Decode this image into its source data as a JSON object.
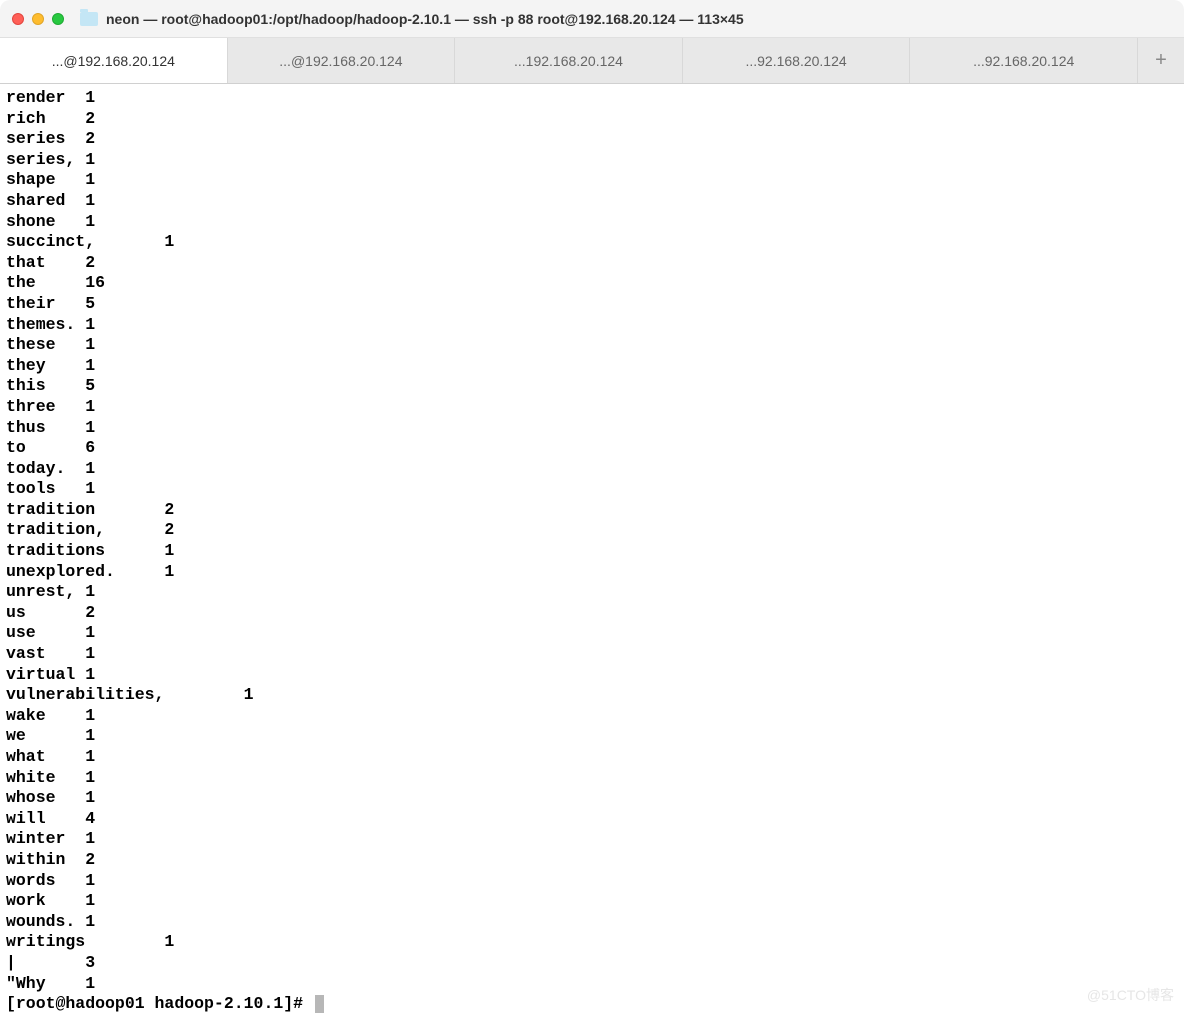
{
  "window": {
    "title": "neon — root@hadoop01:/opt/hadoop/hadoop-2.10.1 — ssh -p 88 root@192.168.20.124 — 113×45"
  },
  "tabs": [
    {
      "label": "...@192.168.20.124",
      "active": true
    },
    {
      "label": "...@192.168.20.124",
      "active": false
    },
    {
      "label": "...192.168.20.124",
      "active": false
    },
    {
      "label": "...92.168.20.124",
      "active": false
    },
    {
      "label": "...92.168.20.124",
      "active": false
    }
  ],
  "tab_add_glyph": "+",
  "terminal": {
    "col1_width": 8,
    "col1_width_long": 16,
    "wordcounts": [
      {
        "word": "render",
        "count": 1,
        "tab": 8
      },
      {
        "word": "rich",
        "count": 2,
        "tab": 8
      },
      {
        "word": "series",
        "count": 2,
        "tab": 8
      },
      {
        "word": "series,",
        "count": 1,
        "tab": 8
      },
      {
        "word": "shape",
        "count": 1,
        "tab": 8
      },
      {
        "word": "shared",
        "count": 1,
        "tab": 8
      },
      {
        "word": "shone",
        "count": 1,
        "tab": 8
      },
      {
        "word": "succinct,",
        "count": 1,
        "tab": 16
      },
      {
        "word": "that",
        "count": 2,
        "tab": 8
      },
      {
        "word": "the",
        "count": 16,
        "tab": 8
      },
      {
        "word": "their",
        "count": 5,
        "tab": 8
      },
      {
        "word": "themes.",
        "count": 1,
        "tab": 8
      },
      {
        "word": "these",
        "count": 1,
        "tab": 8
      },
      {
        "word": "they",
        "count": 1,
        "tab": 8
      },
      {
        "word": "this",
        "count": 5,
        "tab": 8
      },
      {
        "word": "three",
        "count": 1,
        "tab": 8
      },
      {
        "word": "thus",
        "count": 1,
        "tab": 8
      },
      {
        "word": "to",
        "count": 6,
        "tab": 8
      },
      {
        "word": "today.",
        "count": 1,
        "tab": 8
      },
      {
        "word": "tools",
        "count": 1,
        "tab": 8
      },
      {
        "word": "tradition",
        "count": 2,
        "tab": 16
      },
      {
        "word": "tradition,",
        "count": 2,
        "tab": 16
      },
      {
        "word": "traditions",
        "count": 1,
        "tab": 16
      },
      {
        "word": "unexplored.",
        "count": 1,
        "tab": 16
      },
      {
        "word": "unrest,",
        "count": 1,
        "tab": 8
      },
      {
        "word": "us",
        "count": 2,
        "tab": 8
      },
      {
        "word": "use",
        "count": 1,
        "tab": 8
      },
      {
        "word": "vast",
        "count": 1,
        "tab": 8
      },
      {
        "word": "virtual",
        "count": 1,
        "tab": 8
      },
      {
        "word": "vulnerabilities,",
        "count": 1,
        "tab": 24
      },
      {
        "word": "wake",
        "count": 1,
        "tab": 8
      },
      {
        "word": "we",
        "count": 1,
        "tab": 8
      },
      {
        "word": "what",
        "count": 1,
        "tab": 8
      },
      {
        "word": "white",
        "count": 1,
        "tab": 8
      },
      {
        "word": "whose",
        "count": 1,
        "tab": 8
      },
      {
        "word": "will",
        "count": 4,
        "tab": 8
      },
      {
        "word": "winter",
        "count": 1,
        "tab": 8
      },
      {
        "word": "within",
        "count": 2,
        "tab": 8
      },
      {
        "word": "words",
        "count": 1,
        "tab": 8
      },
      {
        "word": "work",
        "count": 1,
        "tab": 8
      },
      {
        "word": "wounds.",
        "count": 1,
        "tab": 8
      },
      {
        "word": "writings",
        "count": 1,
        "tab": 16
      },
      {
        "word": "|",
        "count": 3,
        "tab": 8
      },
      {
        "word": "\"Why",
        "count": 1,
        "tab": 8
      }
    ],
    "prompt": "[root@hadoop01 hadoop-2.10.1]# "
  },
  "watermark": "@51CTO博客"
}
